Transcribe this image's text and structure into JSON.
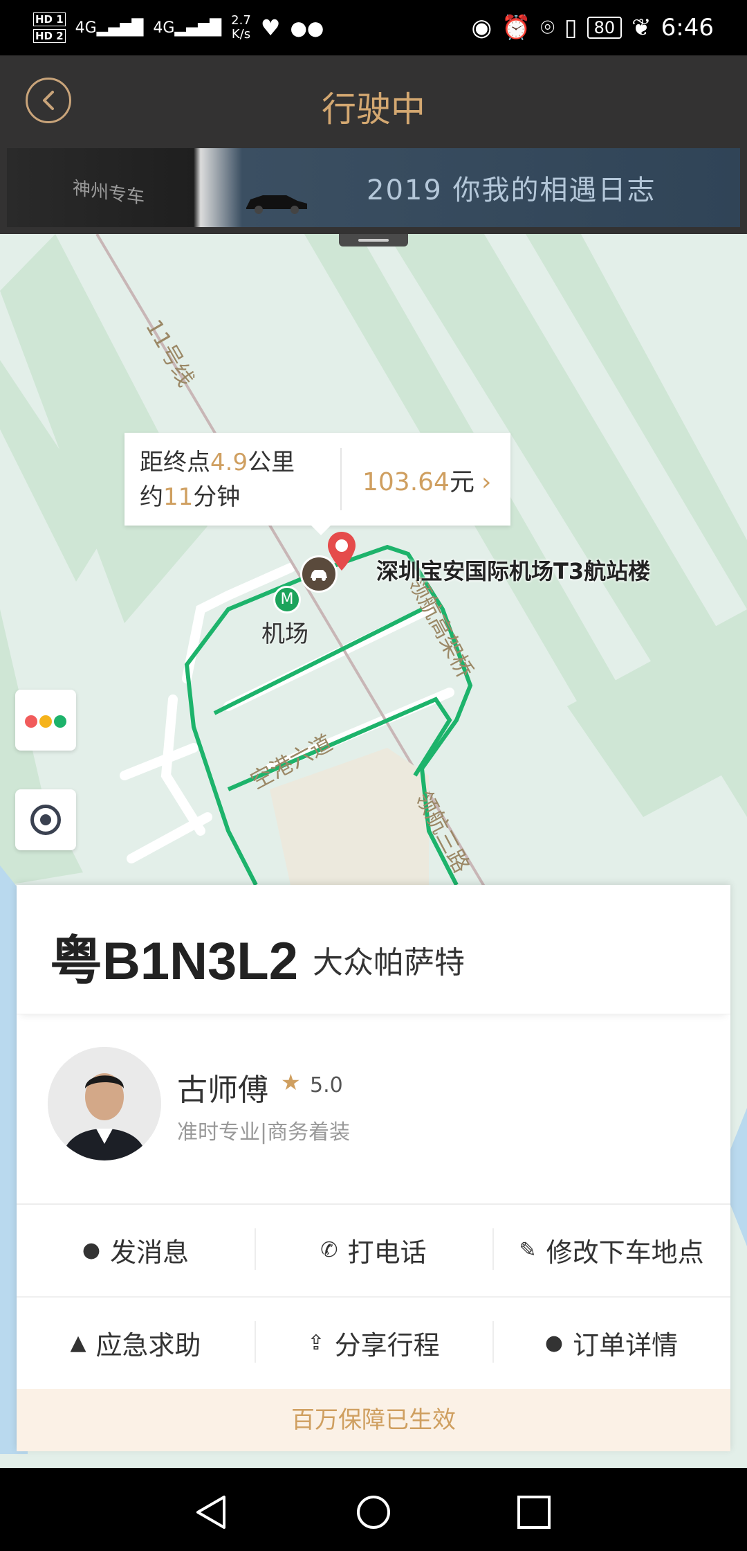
{
  "status_bar": {
    "hd1": "HD 1",
    "hd2": "HD 2",
    "signal1": "4G",
    "signal2": "4G",
    "speed": "2.7",
    "speed_unit": "K/s",
    "battery": "80",
    "time": "6:46"
  },
  "header": {
    "title": "行驶中",
    "banner_logo": "神州专车",
    "banner_text": "2019 你我的相遇日志"
  },
  "map": {
    "info_bubble": {
      "line1_prefix": "距终点",
      "distance": "4.9",
      "line1_suffix": "公里",
      "line2_prefix": "约",
      "minutes": "11",
      "line2_suffix": "分钟",
      "fare": "103.64",
      "fare_unit": "元"
    },
    "destination": "深圳宝安国际机场T3航站楼",
    "metro_station": "机场",
    "road_labels": [
      "空港六道",
      "领航高架桥",
      "领航三路",
      "11号线"
    ],
    "colors": {
      "route": "#1db36b",
      "gold": "#cf9f60",
      "pin": "#e54b4b"
    }
  },
  "trip_card": {
    "plate": "粤B1N3L2",
    "car_model": "大众帕萨特",
    "driver": {
      "name": "古师傅",
      "rating": "5.0",
      "tags": "准时专业|商务着装"
    },
    "actions": {
      "message": "发消息",
      "call": "打电话",
      "change_dropoff": "修改下车地点",
      "emergency": "应急求助",
      "share": "分享行程",
      "order_details": "订单详情"
    },
    "guarantee": "百万保障已生效"
  }
}
